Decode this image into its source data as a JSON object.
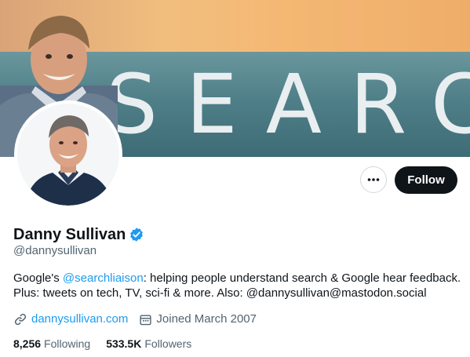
{
  "banner": {
    "text": "SEARCH"
  },
  "actions": {
    "more_label": "More",
    "follow_label": "Follow"
  },
  "profile": {
    "name": "Danny Sullivan",
    "handle": "@dannysullivan",
    "verified": true,
    "bio": {
      "pre": "Google's ",
      "mention": "@searchliaison",
      "post": ": helping people understand search & Google hear feedback. Plus: tweets on tech, TV, sci-fi & more. Also: @dannysullivan@mastodon.social"
    },
    "website": "dannysullivan.com",
    "joined": "Joined March 2007"
  },
  "stats": {
    "following_count": "8,256",
    "following_label": "Following",
    "followers_count": "533.5K",
    "followers_label": "Followers"
  },
  "icons": {
    "link": "link-icon",
    "calendar": "calendar-icon",
    "verified": "verified-badge-icon",
    "more": "more-dots-icon"
  },
  "colors": {
    "accent": "#1d9bf0",
    "text": "#0f1419",
    "secondary": "#536471",
    "follow_bg": "#0f1419"
  }
}
